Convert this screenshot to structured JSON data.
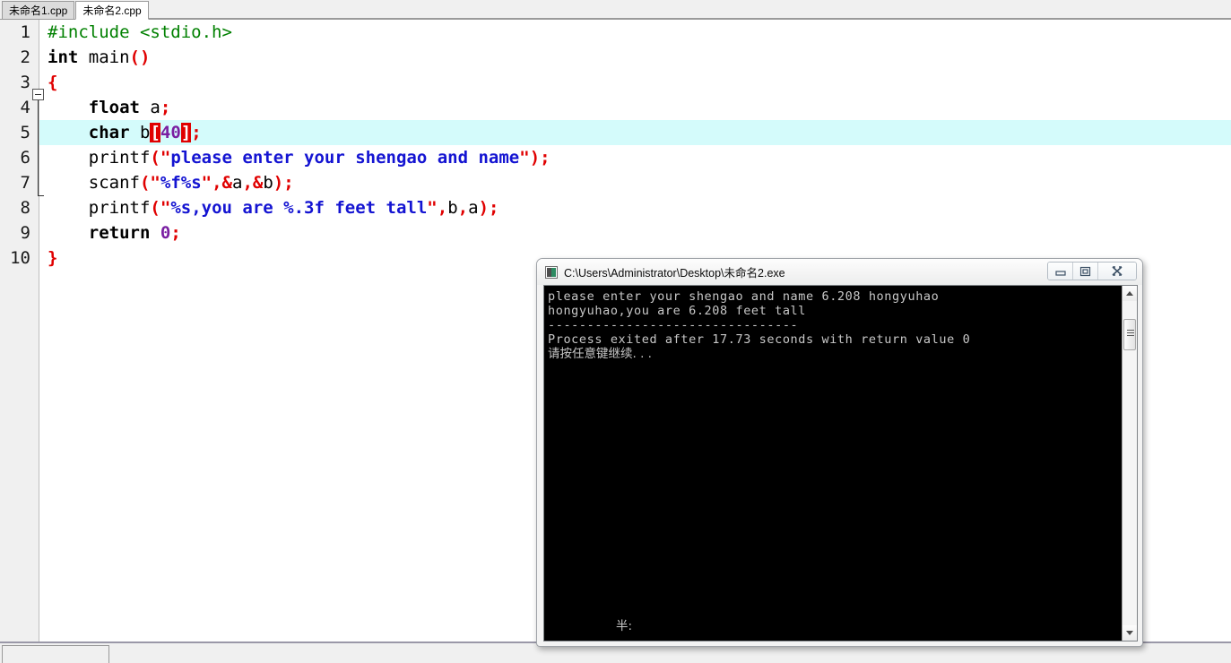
{
  "app": {
    "name": "dev-cpp-editor"
  },
  "tabs": [
    {
      "label": "未命名1.cpp",
      "active": false
    },
    {
      "label": "未命名2.cpp",
      "active": true
    }
  ],
  "editor": {
    "line_numbers": [
      "1",
      "2",
      "3",
      "4",
      "5",
      "6",
      "7",
      "8",
      "9",
      "10"
    ],
    "highlighted_line": "5",
    "highlight_color": "#d4fbfb",
    "fold_marker_line": "3",
    "code_lines": [
      {
        "n": "1",
        "text": "#include <stdio.h>"
      },
      {
        "n": "2",
        "text": "int main()"
      },
      {
        "n": "3",
        "text": "{"
      },
      {
        "n": "4",
        "text": "    float a;"
      },
      {
        "n": "5",
        "text": "    char b[40];"
      },
      {
        "n": "6",
        "text": "    printf(\"please enter your shengao and name\");"
      },
      {
        "n": "7",
        "text": "    scanf(\"%f%s\",&a,&b);"
      },
      {
        "n": "8",
        "text": "    printf(\"%s,you are %.3f feet tall\",b,a);"
      },
      {
        "n": "9",
        "text": "    return 0;"
      },
      {
        "n": "10",
        "text": "}"
      }
    ],
    "tokens": {
      "l1_include": "#include <stdio.h>",
      "l2_int": "int",
      "l2_space": " ",
      "l2_main": "main",
      "l2_parens": "()",
      "l3_brace": "{",
      "l4_indent": "    ",
      "l4_float": "float",
      "l4_sp": " ",
      "l4_a": "a",
      "l4_semi": ";",
      "l5_indent": "    ",
      "l5_char": "char",
      "l5_sp": " ",
      "l5_b": "b",
      "l5_lbrk": "[",
      "l5_40": "40",
      "l5_rbrk": "]",
      "l5_semi": ";",
      "l6_indent": "    ",
      "l6_printf": "printf",
      "l6_lpar": "(",
      "l6_q1": "\"",
      "l6_str": "please enter your shengao and name",
      "l6_q2": "\"",
      "l6_end": ");",
      "l7_indent": "    ",
      "l7_scanf": "scanf",
      "l7_lpar": "(",
      "l7_q1": "\"",
      "l7_str": "%f%s",
      "l7_q2": "\"",
      "l7_comma1": ",&",
      "l7_a": "a",
      "l7_comma2": ",&",
      "l7_b": "b",
      "l7_end": ");",
      "l8_indent": "    ",
      "l8_printf": "printf",
      "l8_lpar": "(",
      "l8_q1": "\"",
      "l8_str": "%s,you are %.3f feet tall",
      "l8_q2": "\"",
      "l8_comma1": ",",
      "l8_b": "b",
      "l8_comma2": ",",
      "l8_a": "a",
      "l8_end": ");",
      "l9_indent": "    ",
      "l9_return": "return",
      "l9_sp": " ",
      "l9_zero": "0",
      "l9_semi": ";",
      "l10_brace": "}"
    },
    "colors": {
      "preprocessor": "#008000",
      "keyword": "#000000",
      "punctuation": "#e00000",
      "string": "#1414d2",
      "number": "#7a1fa2",
      "bracket_match_bg": "#e00000",
      "bracket_match_fg": "#ffffff",
      "gutter_bg": "#f0f0f0"
    }
  },
  "console_window": {
    "title": "C:\\Users\\Administrator\\Desktop\\未命名2.exe",
    "icon": "console-app-icon",
    "controls": {
      "minimize": "minimize-icon",
      "restore": "restore-icon",
      "close": "close-icon"
    },
    "output_lines": [
      "please enter your shengao and name 6.208 hongyuhao",
      "hongyuhao,you are 6.208 feet tall",
      "--------------------------------",
      "Process exited after 17.73 seconds with return value 0",
      "请按任意键继续. . ."
    ],
    "bottom_text": "半:",
    "scrollbar": {
      "up_arrow": "scroll-up-arrow-icon",
      "down_arrow": "scroll-down-arrow-icon",
      "thumb": "scrollbar-thumb"
    },
    "background": "#000000",
    "foreground": "#c8c8c8"
  }
}
